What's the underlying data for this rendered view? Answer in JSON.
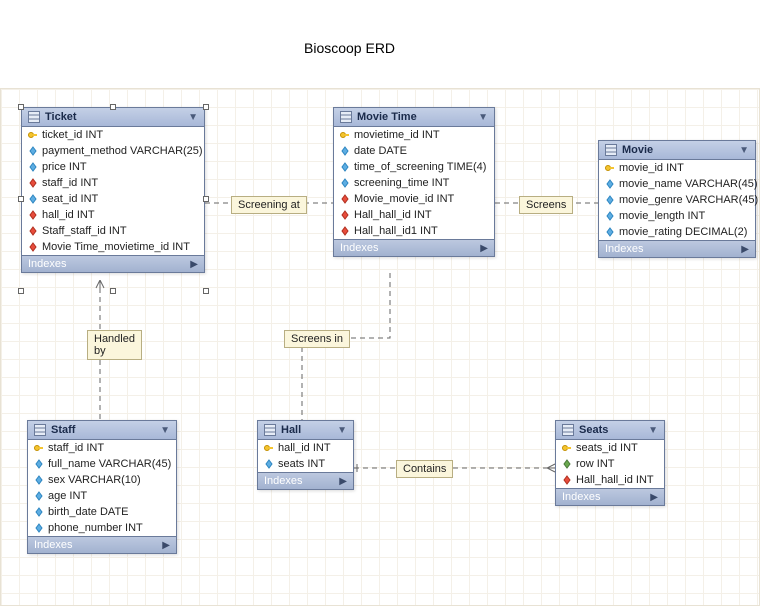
{
  "title": "Bioscoop ERD",
  "entities": {
    "ticket": {
      "name": "Ticket",
      "attrs": [
        {
          "icon": "key",
          "text": "ticket_id INT"
        },
        {
          "icon": "col",
          "text": "payment_method VARCHAR(25)"
        },
        {
          "icon": "col",
          "text": "price INT"
        },
        {
          "icon": "fk",
          "text": "staff_id INT"
        },
        {
          "icon": "col",
          "text": "seat_id INT"
        },
        {
          "icon": "fk",
          "text": "hall_id INT"
        },
        {
          "icon": "fk",
          "text": "Staff_staff_id INT"
        },
        {
          "icon": "fk",
          "text": "Movie Time_movietime_id INT"
        }
      ],
      "footer": "Indexes"
    },
    "movietime": {
      "name": "Movie Time",
      "attrs": [
        {
          "icon": "key",
          "text": "movietime_id INT"
        },
        {
          "icon": "col",
          "text": "date DATE"
        },
        {
          "icon": "col",
          "text": "time_of_screening TIME(4)"
        },
        {
          "icon": "col",
          "text": "screening_time INT"
        },
        {
          "icon": "fk",
          "text": "Movie_movie_id INT"
        },
        {
          "icon": "fk",
          "text": "Hall_hall_id INT"
        },
        {
          "icon": "fk",
          "text": "Hall_hall_id1 INT"
        }
      ],
      "footer": "Indexes"
    },
    "movie": {
      "name": "Movie",
      "attrs": [
        {
          "icon": "key",
          "text": "movie_id INT"
        },
        {
          "icon": "col",
          "text": "movie_name VARCHAR(45)"
        },
        {
          "icon": "col",
          "text": "movie_genre VARCHAR(45)"
        },
        {
          "icon": "col",
          "text": "movie_length INT"
        },
        {
          "icon": "col",
          "text": "movie_rating DECIMAL(2)"
        }
      ],
      "footer": "Indexes"
    },
    "staff": {
      "name": "Staff",
      "attrs": [
        {
          "icon": "key",
          "text": "staff_id INT"
        },
        {
          "icon": "col",
          "text": "full_name VARCHAR(45)"
        },
        {
          "icon": "col",
          "text": "sex VARCHAR(10)"
        },
        {
          "icon": "col",
          "text": "age INT"
        },
        {
          "icon": "col",
          "text": "birth_date DATE"
        },
        {
          "icon": "col",
          "text": "phone_number INT"
        }
      ],
      "footer": "Indexes"
    },
    "hall": {
      "name": "Hall",
      "attrs": [
        {
          "icon": "key",
          "text": "hall_id INT"
        },
        {
          "icon": "col",
          "text": "seats INT"
        }
      ],
      "footer": "Indexes"
    },
    "seats": {
      "name": "Seats",
      "attrs": [
        {
          "icon": "key",
          "text": "seats_id INT"
        },
        {
          "icon": "col2",
          "text": "row INT"
        },
        {
          "icon": "fk",
          "text": "Hall_hall_id INT"
        }
      ],
      "footer": "Indexes"
    }
  },
  "relations": {
    "screening_at": "Screening at",
    "screens": "Screens",
    "handled_by": "Handled\nby",
    "screens_in": "Screens in",
    "contains": "Contains"
  }
}
